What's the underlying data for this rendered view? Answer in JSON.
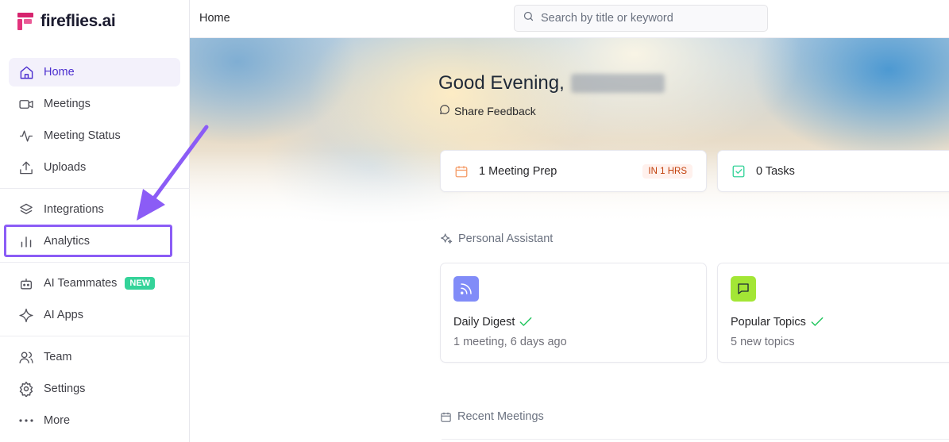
{
  "brand": {
    "name": "fireflies.ai",
    "color": "#d6246e"
  },
  "sidebar": {
    "items": [
      {
        "label": "Home",
        "icon": "home-icon",
        "active": true
      },
      {
        "label": "Meetings",
        "icon": "video-icon"
      },
      {
        "label": "Meeting Status",
        "icon": "activity-icon"
      },
      {
        "label": "Uploads",
        "icon": "upload-icon"
      },
      {
        "label": "Integrations",
        "icon": "layers-icon"
      },
      {
        "label": "Analytics",
        "icon": "bar-chart-icon"
      },
      {
        "label": "AI Teammates",
        "icon": "bot-icon",
        "badge": "NEW"
      },
      {
        "label": "AI Apps",
        "icon": "sparkle-icon"
      },
      {
        "label": "Team",
        "icon": "users-icon"
      },
      {
        "label": "Settings",
        "icon": "gear-icon"
      },
      {
        "label": "More",
        "icon": "more-dots-icon"
      }
    ]
  },
  "topbar": {
    "breadcrumb": "Home",
    "search_placeholder": "Search by title or keyword"
  },
  "main": {
    "greeting": "Good Evening,",
    "share_feedback": "Share Feedback",
    "summary_cards": [
      {
        "label": "1 Meeting Prep",
        "tag": "IN 1 HRS",
        "icon": "calendar-icon"
      },
      {
        "label": "0 Tasks",
        "icon": "check-square-icon"
      }
    ],
    "personal_assistant_title": "Personal Assistant",
    "assistant_cards": [
      {
        "title": "Daily Digest",
        "subtitle": "1 meeting, 6 days ago",
        "icon": "rss-icon",
        "icon_bg": "#818cf8"
      },
      {
        "title": "Popular Topics",
        "subtitle": "5 new topics",
        "icon": "message-square-icon",
        "icon_bg": "#a3e635"
      }
    ],
    "recent_meetings_title": "Recent Meetings"
  },
  "colors": {
    "accent": "#4c2fcf",
    "highlight": "#8b5cf6",
    "check": "#22c55e"
  }
}
